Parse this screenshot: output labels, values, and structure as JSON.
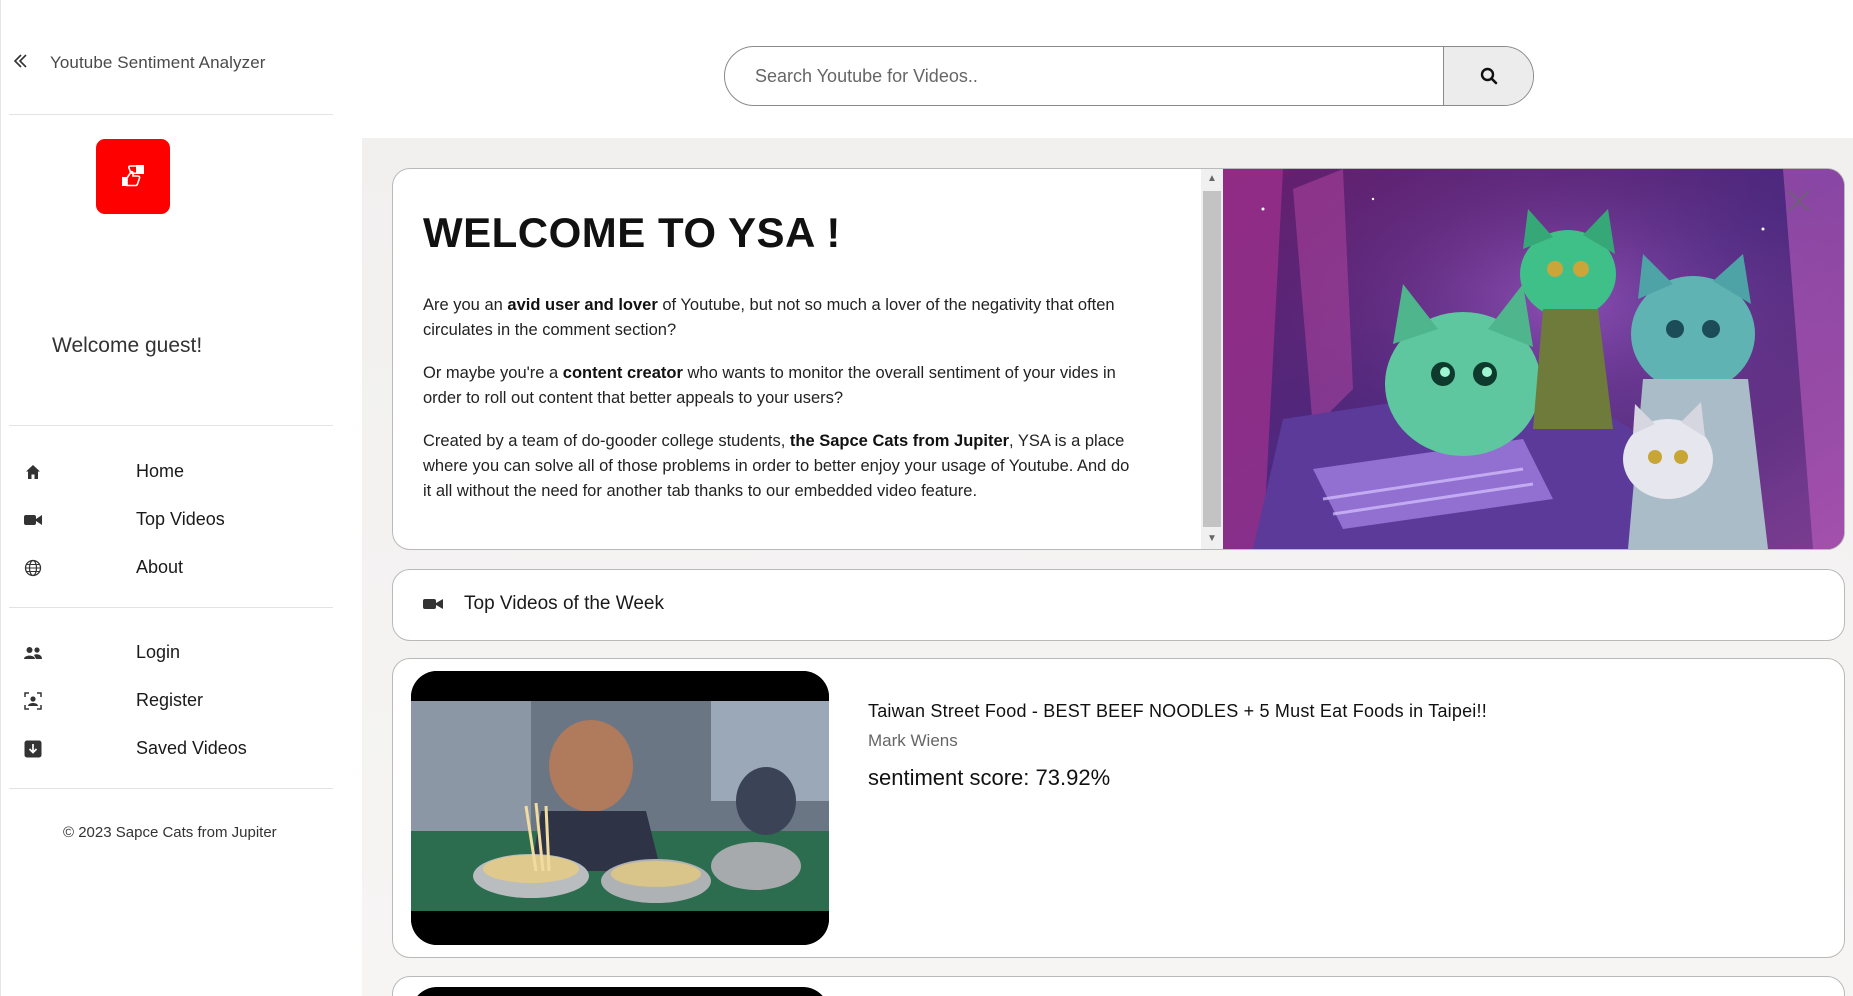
{
  "app": {
    "title": "Youtube Sentiment Analyzer"
  },
  "sidebar": {
    "welcome": "Welcome guest!",
    "nav_main": [
      {
        "label": "Home",
        "icon": "home-icon"
      },
      {
        "label": "Top Videos",
        "icon": "video-camera-icon"
      },
      {
        "label": "About",
        "icon": "globe-icon"
      }
    ],
    "nav_account": [
      {
        "label": "Login",
        "icon": "users-icon"
      },
      {
        "label": "Register",
        "icon": "id-badge-icon"
      },
      {
        "label": "Saved Videos",
        "icon": "download-icon"
      }
    ],
    "copyright": "© 2023 Sapce Cats from Jupiter"
  },
  "search": {
    "placeholder": "Search Youtube for Videos.."
  },
  "welcome_card": {
    "title": "WELCOME TO YSA !",
    "p1_a": "Are you an ",
    "p1_b": "avid user and lover",
    "p1_c": " of Youtube, but not so much a lover of the negativity that often circulates in the comment section?",
    "p2_a": "Or maybe you're a ",
    "p2_b": "content creator",
    "p2_c": " who wants to monitor the overall sentiment of your vides in order to roll out content that better appeals to your users?",
    "p3_a": "Created by a team of do-gooder college students, ",
    "p3_b": "the Sapce Cats from Jupiter",
    "p3_c": ", YSA is a place where you can solve all of those problems in order to better enjoy your usage of Youtube. And do it all without the need for another tab thanks to our embedded video feature."
  },
  "top_videos": {
    "label": "Top Videos of the Week"
  },
  "videos": [
    {
      "title": "Taiwan Street Food - BEST BEEF NOODLES + 5 Must Eat Foods in Taipei!!",
      "channel": "Mark Wiens",
      "sentiment": "sentiment score: 73.92%"
    }
  ],
  "colors": {
    "brand_red": "#ff0000",
    "hero_purple": "#4b1a55"
  }
}
